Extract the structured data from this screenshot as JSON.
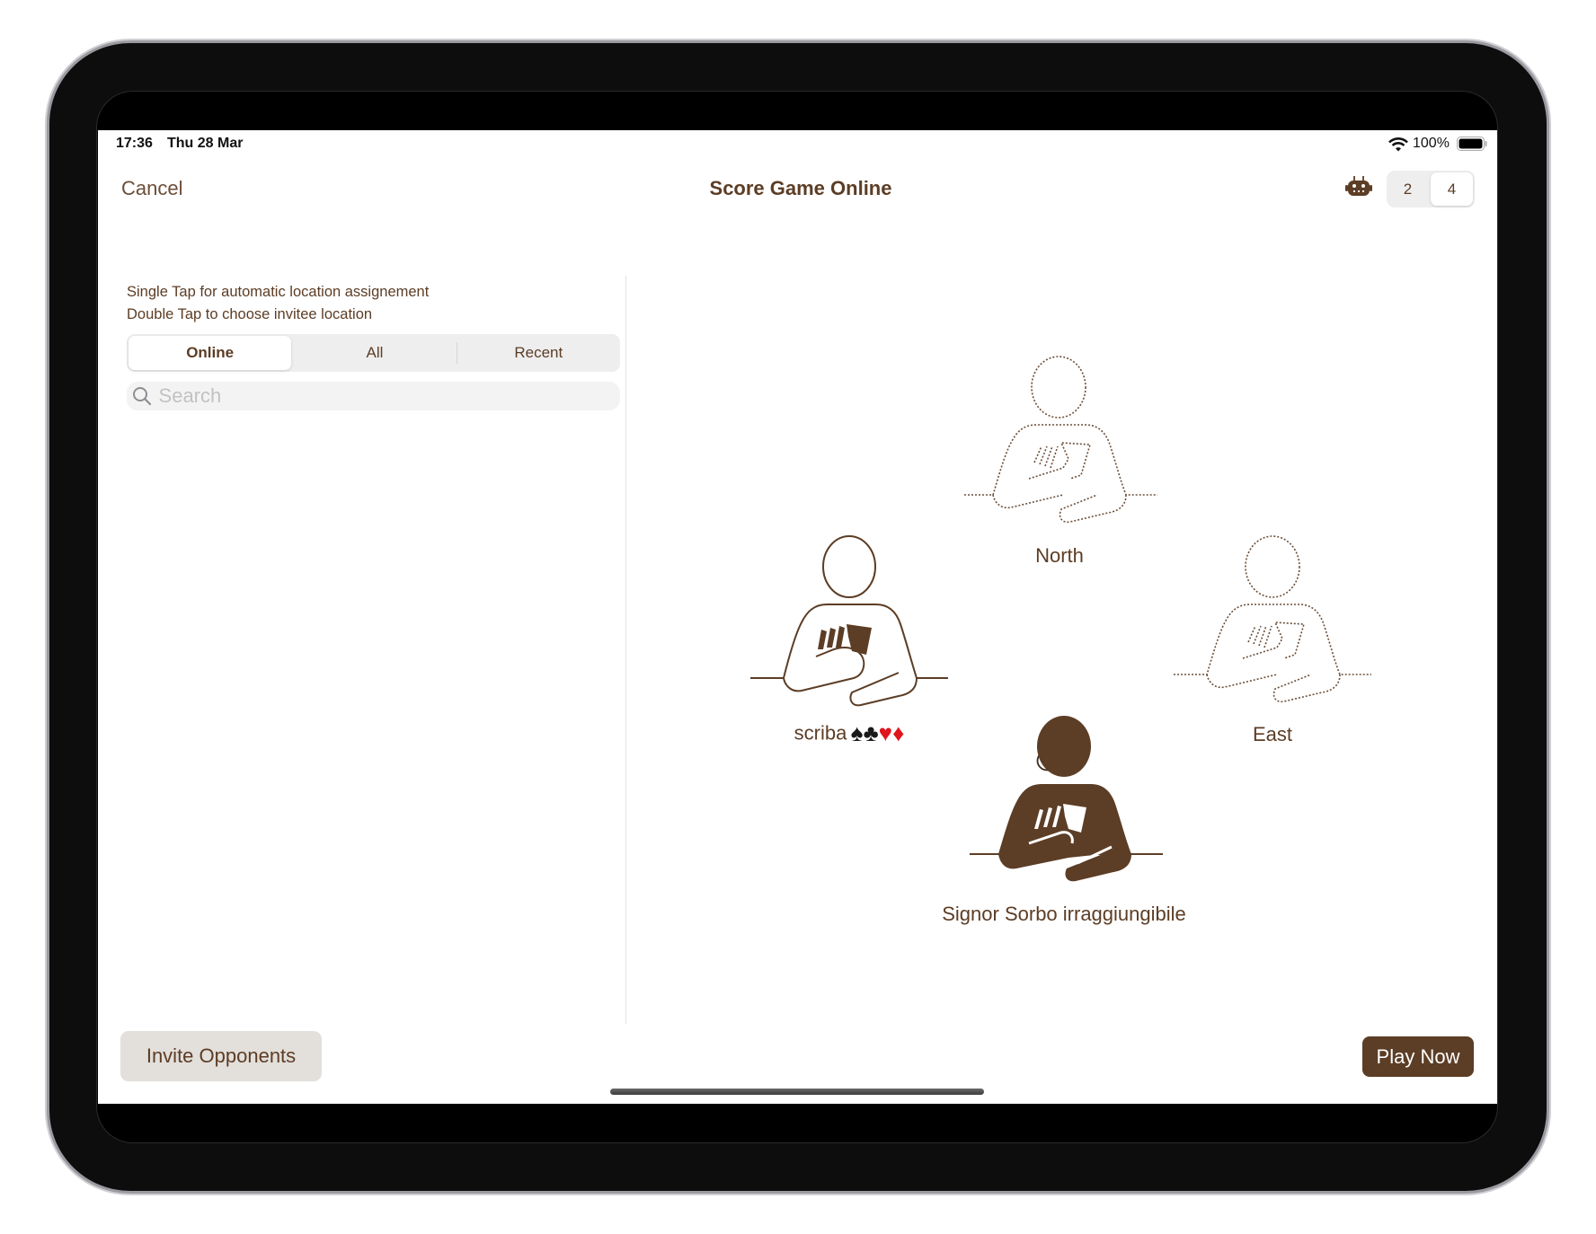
{
  "status_bar": {
    "time": "17:36",
    "date": "Thu 28 Mar",
    "battery": "100%"
  },
  "nav": {
    "cancel_label": "Cancel",
    "title": "Score Game Online",
    "player_count_options": [
      "2",
      "4"
    ],
    "player_count_selected": "4",
    "bot_icon": "robot-icon"
  },
  "left_panel": {
    "instructions": [
      "Single Tap for automatic location assignement",
      "Double Tap to choose invitee location"
    ],
    "filter_tabs": [
      {
        "label": "Online",
        "selected": true
      },
      {
        "label": "All",
        "selected": false
      },
      {
        "label": "Recent",
        "selected": false
      }
    ],
    "search": {
      "placeholder": "Search",
      "value": ""
    }
  },
  "table": {
    "seats": [
      {
        "position": "North",
        "label": "North",
        "state": "empty"
      },
      {
        "position": "West",
        "label": "scriba",
        "suits": [
          "♠",
          "♣",
          "♥",
          "♦"
        ],
        "state": "occupied",
        "removable": true
      },
      {
        "position": "East",
        "label": "East",
        "state": "empty"
      },
      {
        "position": "South",
        "label": "Signor Sorbo irraggiungibile",
        "state": "self"
      }
    ]
  },
  "footer": {
    "invite_label": "Invite Opponents",
    "play_label": "Play Now"
  },
  "colors": {
    "brand": "#5c3d25",
    "spade_club": "#1a1a1a",
    "heart_diamond": "#e0141b"
  }
}
